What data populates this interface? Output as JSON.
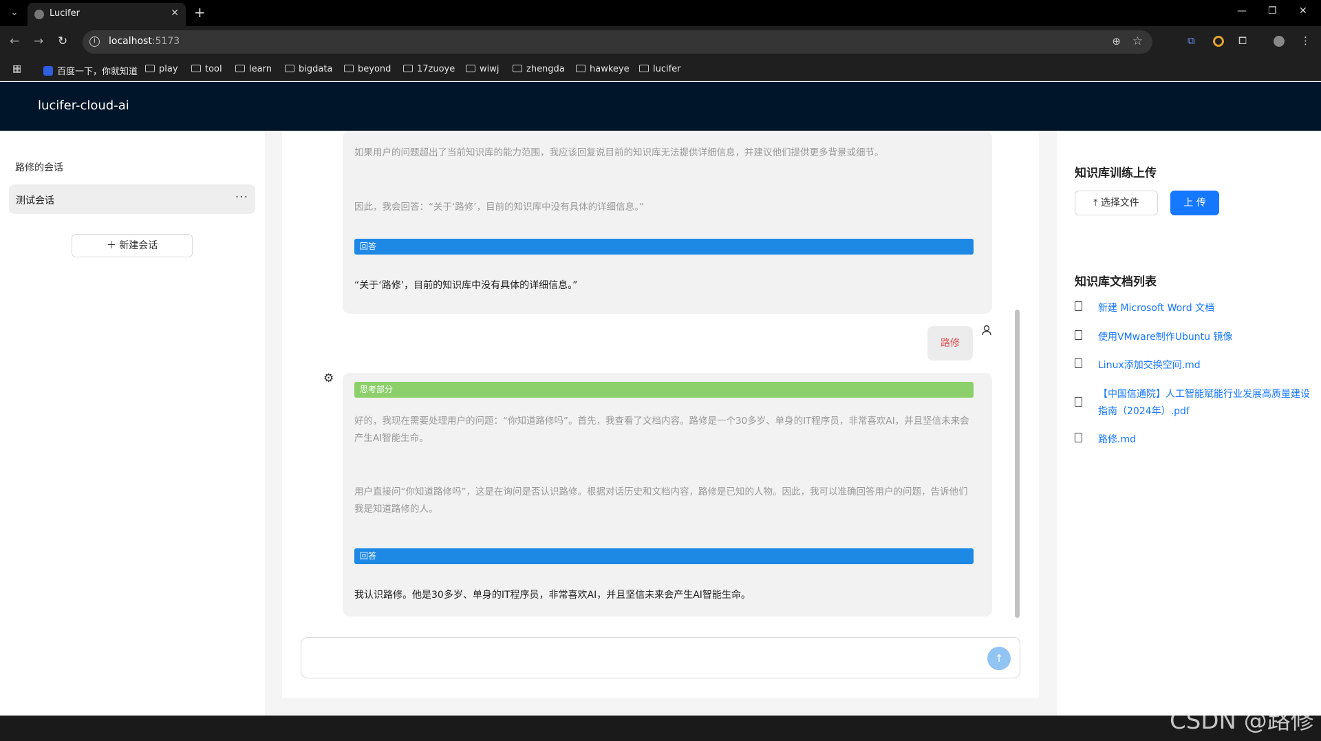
{
  "browser": {
    "tab_title": "Lucifer",
    "url_host": "localhost",
    "url_port": ":5173",
    "bookmarks": [
      "百度一下，你就知道",
      "play",
      "tool",
      "learn",
      "bigdata",
      "beyond",
      "17zuoye",
      "wiwj",
      "zhengda",
      "hawkeye",
      "lucifer"
    ]
  },
  "app": {
    "title": "lucifer-cloud-ai"
  },
  "sidebar": {
    "title": "路修的会话",
    "conversations": [
      {
        "label": "测试会话"
      }
    ],
    "new_button": "新建会话"
  },
  "chat": {
    "first_msg": {
      "thought_line_1": "如果用户的问题超出了当前知识库的能力范围，我应该回复说目前的知识库无法提供详细信息，并建议他们提供更多背景或细节。",
      "thought_line_2": "因此，我会回答：“关于‘路修’，目前的知识库中没有具体的详细信息。”",
      "answer_label": "回答",
      "answer": "“关于‘路修’，目前的知识库中没有具体的详细信息。”"
    },
    "user_msg": "路修",
    "second_msg": {
      "think_label": "思考部分",
      "thought_para_1": "好的，我现在需要处理用户的问题：“你知道路修吗”。首先，我查看了文档内容。路修是一个30多岁、单身的IT程序员，非常喜欢AI，并且坚信未来会产生AI智能生命。",
      "thought_para_2": "用户直接问“你知道路修吗”，这是在询问是否认识路修。根据对话历史和文档内容，路修是已知的人物。因此，我可以准确回答用户的问题，告诉他们我是知道路修的人。",
      "answer_label": "回答",
      "answer": "我认识路修。他是30多岁、单身的IT程序员，非常喜欢AI，并且坚信未来会产生AI智能生命。"
    },
    "input_placeholder": ""
  },
  "right_panel": {
    "upload_title": "知识库训练上传",
    "select_file": "选择文件",
    "upload_button": "上 传",
    "list_title": "知识库文档列表",
    "docs": [
      "新建 Microsoft Word 文档",
      "使用VMware制作Ubuntu 镜像",
      "Linux添加交换空间.md",
      "【中国信通院】人工智能赋能行业发展高质量建设指南（2024年）.pdf",
      "路修.md"
    ]
  },
  "watermark": "CSDN @路修",
  "colors": {
    "header_bg": "#001529",
    "answer_bar": "#1e88e5",
    "think_bar": "#8bd06a",
    "primary": "#1677ff",
    "user_text": "#e05050"
  }
}
